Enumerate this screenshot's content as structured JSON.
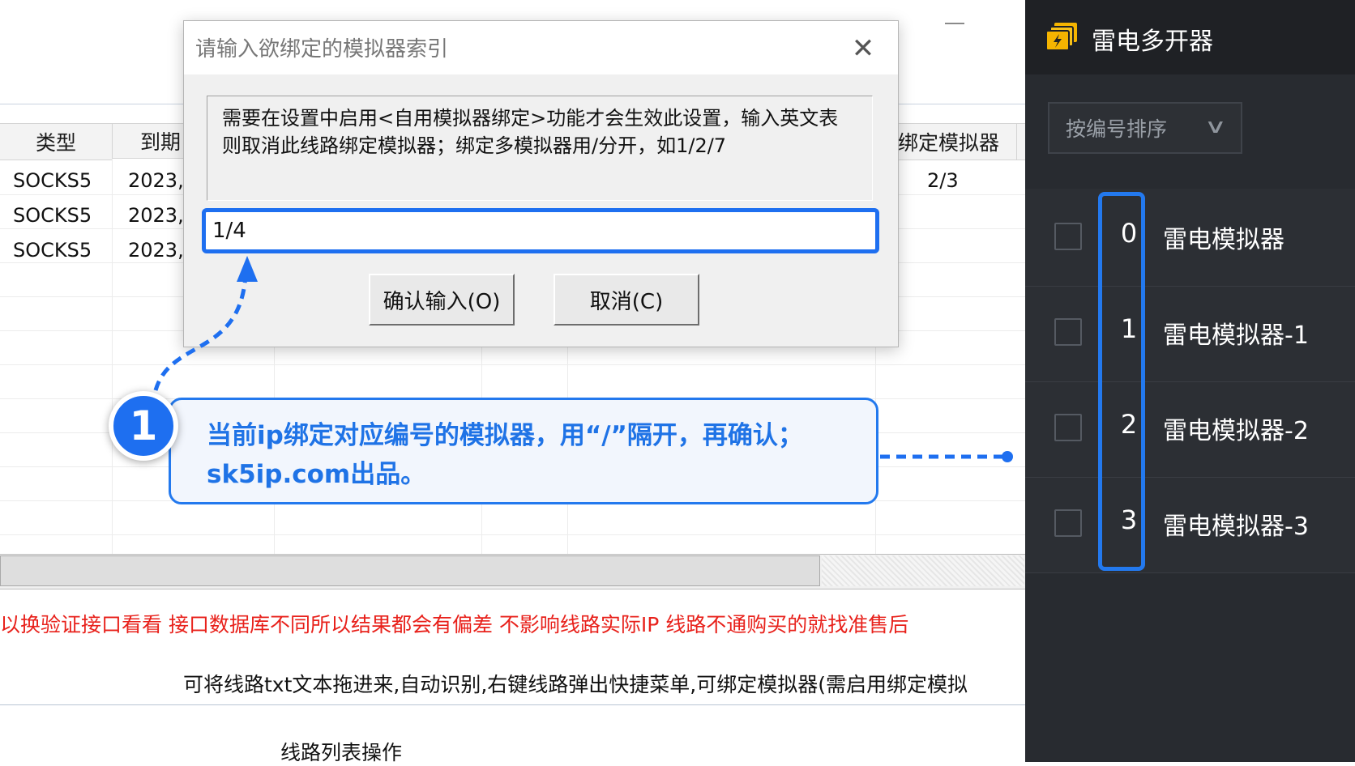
{
  "background_app": {
    "columns": {
      "type": "类型",
      "expiry": "到期",
      "bound_emulator": "绑定模拟器"
    },
    "rows": [
      {
        "type": "SOCKS5",
        "expiry": "2023,",
        "bound": "2/3"
      },
      {
        "type": "SOCKS5",
        "expiry": "2023,",
        "bound": ""
      },
      {
        "type": "SOCKS5",
        "expiry": "2023,",
        "bound": ""
      }
    ],
    "notice_red": "以换验证接口看看 接口数据库不同所以结果都会有偏差 不影响线路实际IP 线路不通购买的就找准售后",
    "notice_black": "可将线路txt文本拖进来,自动识别,右键线路弹出快捷菜单,可绑定模拟器(需启用绑定模拟",
    "section_label": "线路列表操作"
  },
  "dialog": {
    "title": "请输入欲绑定的模拟器索引",
    "close_icon": "close-icon",
    "message": "需要在设置中启用<自用模拟器绑定>功能才会生效此设置，输入英文表则取消此线路绑定模拟器；绑定多模拟器用/分开，如1/2/7",
    "input_value": "1/4",
    "confirm_label": "确认输入(O)",
    "cancel_label": "取消(C)"
  },
  "annotation": {
    "step_number": "1",
    "text": "当前ip绑定对应编号的模拟器，用“/”隔开，再确认；sk5ip.com出品。",
    "accent_color": "#1e6ff0"
  },
  "ld_panel": {
    "title": "雷电多开器",
    "logo_icon": "ldplayer-logo-icon",
    "sort_label": "按编号排序",
    "emulators": [
      {
        "index": "0",
        "name": "雷电模拟器"
      },
      {
        "index": "1",
        "name": "雷电模拟器-1"
      },
      {
        "index": "2",
        "name": "雷电模拟器-2"
      },
      {
        "index": "3",
        "name": "雷电模拟器-3"
      }
    ]
  }
}
